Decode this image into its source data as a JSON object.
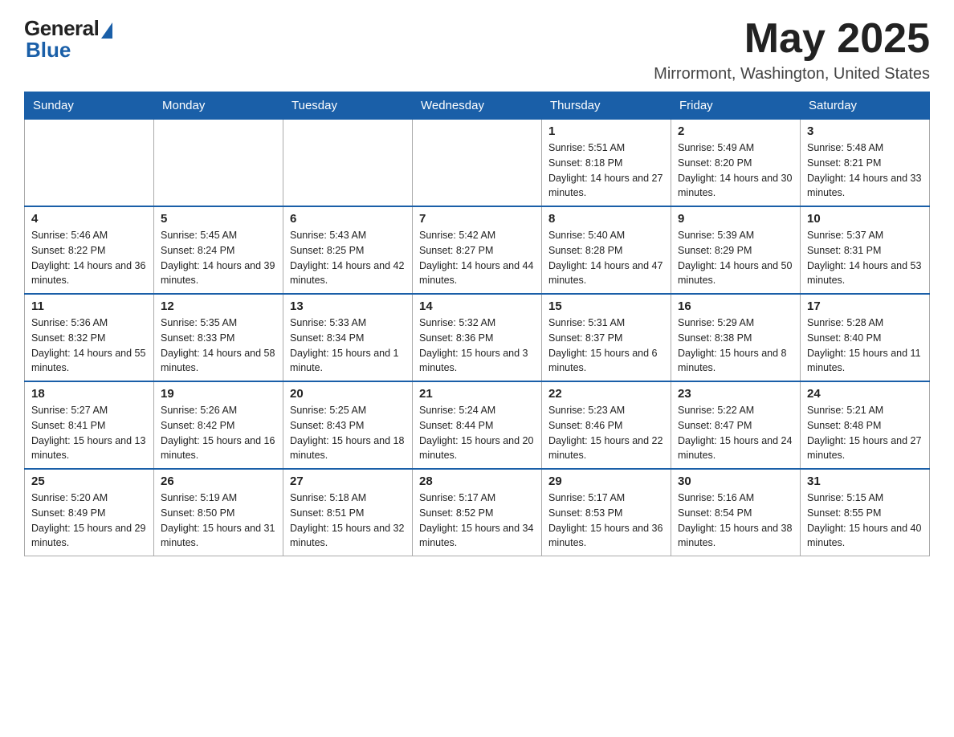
{
  "header": {
    "logo_general": "General",
    "logo_blue": "Blue",
    "month_title": "May 2025",
    "location": "Mirrormont, Washington, United States"
  },
  "weekdays": [
    "Sunday",
    "Monday",
    "Tuesday",
    "Wednesday",
    "Thursday",
    "Friday",
    "Saturday"
  ],
  "weeks": [
    [
      {
        "day": "",
        "sunrise": "",
        "sunset": "",
        "daylight": ""
      },
      {
        "day": "",
        "sunrise": "",
        "sunset": "",
        "daylight": ""
      },
      {
        "day": "",
        "sunrise": "",
        "sunset": "",
        "daylight": ""
      },
      {
        "day": "",
        "sunrise": "",
        "sunset": "",
        "daylight": ""
      },
      {
        "day": "1",
        "sunrise": "Sunrise: 5:51 AM",
        "sunset": "Sunset: 8:18 PM",
        "daylight": "Daylight: 14 hours and 27 minutes."
      },
      {
        "day": "2",
        "sunrise": "Sunrise: 5:49 AM",
        "sunset": "Sunset: 8:20 PM",
        "daylight": "Daylight: 14 hours and 30 minutes."
      },
      {
        "day": "3",
        "sunrise": "Sunrise: 5:48 AM",
        "sunset": "Sunset: 8:21 PM",
        "daylight": "Daylight: 14 hours and 33 minutes."
      }
    ],
    [
      {
        "day": "4",
        "sunrise": "Sunrise: 5:46 AM",
        "sunset": "Sunset: 8:22 PM",
        "daylight": "Daylight: 14 hours and 36 minutes."
      },
      {
        "day": "5",
        "sunrise": "Sunrise: 5:45 AM",
        "sunset": "Sunset: 8:24 PM",
        "daylight": "Daylight: 14 hours and 39 minutes."
      },
      {
        "day": "6",
        "sunrise": "Sunrise: 5:43 AM",
        "sunset": "Sunset: 8:25 PM",
        "daylight": "Daylight: 14 hours and 42 minutes."
      },
      {
        "day": "7",
        "sunrise": "Sunrise: 5:42 AM",
        "sunset": "Sunset: 8:27 PM",
        "daylight": "Daylight: 14 hours and 44 minutes."
      },
      {
        "day": "8",
        "sunrise": "Sunrise: 5:40 AM",
        "sunset": "Sunset: 8:28 PM",
        "daylight": "Daylight: 14 hours and 47 minutes."
      },
      {
        "day": "9",
        "sunrise": "Sunrise: 5:39 AM",
        "sunset": "Sunset: 8:29 PM",
        "daylight": "Daylight: 14 hours and 50 minutes."
      },
      {
        "day": "10",
        "sunrise": "Sunrise: 5:37 AM",
        "sunset": "Sunset: 8:31 PM",
        "daylight": "Daylight: 14 hours and 53 minutes."
      }
    ],
    [
      {
        "day": "11",
        "sunrise": "Sunrise: 5:36 AM",
        "sunset": "Sunset: 8:32 PM",
        "daylight": "Daylight: 14 hours and 55 minutes."
      },
      {
        "day": "12",
        "sunrise": "Sunrise: 5:35 AM",
        "sunset": "Sunset: 8:33 PM",
        "daylight": "Daylight: 14 hours and 58 minutes."
      },
      {
        "day": "13",
        "sunrise": "Sunrise: 5:33 AM",
        "sunset": "Sunset: 8:34 PM",
        "daylight": "Daylight: 15 hours and 1 minute."
      },
      {
        "day": "14",
        "sunrise": "Sunrise: 5:32 AM",
        "sunset": "Sunset: 8:36 PM",
        "daylight": "Daylight: 15 hours and 3 minutes."
      },
      {
        "day": "15",
        "sunrise": "Sunrise: 5:31 AM",
        "sunset": "Sunset: 8:37 PM",
        "daylight": "Daylight: 15 hours and 6 minutes."
      },
      {
        "day": "16",
        "sunrise": "Sunrise: 5:29 AM",
        "sunset": "Sunset: 8:38 PM",
        "daylight": "Daylight: 15 hours and 8 minutes."
      },
      {
        "day": "17",
        "sunrise": "Sunrise: 5:28 AM",
        "sunset": "Sunset: 8:40 PM",
        "daylight": "Daylight: 15 hours and 11 minutes."
      }
    ],
    [
      {
        "day": "18",
        "sunrise": "Sunrise: 5:27 AM",
        "sunset": "Sunset: 8:41 PM",
        "daylight": "Daylight: 15 hours and 13 minutes."
      },
      {
        "day": "19",
        "sunrise": "Sunrise: 5:26 AM",
        "sunset": "Sunset: 8:42 PM",
        "daylight": "Daylight: 15 hours and 16 minutes."
      },
      {
        "day": "20",
        "sunrise": "Sunrise: 5:25 AM",
        "sunset": "Sunset: 8:43 PM",
        "daylight": "Daylight: 15 hours and 18 minutes."
      },
      {
        "day": "21",
        "sunrise": "Sunrise: 5:24 AM",
        "sunset": "Sunset: 8:44 PM",
        "daylight": "Daylight: 15 hours and 20 minutes."
      },
      {
        "day": "22",
        "sunrise": "Sunrise: 5:23 AM",
        "sunset": "Sunset: 8:46 PM",
        "daylight": "Daylight: 15 hours and 22 minutes."
      },
      {
        "day": "23",
        "sunrise": "Sunrise: 5:22 AM",
        "sunset": "Sunset: 8:47 PM",
        "daylight": "Daylight: 15 hours and 24 minutes."
      },
      {
        "day": "24",
        "sunrise": "Sunrise: 5:21 AM",
        "sunset": "Sunset: 8:48 PM",
        "daylight": "Daylight: 15 hours and 27 minutes."
      }
    ],
    [
      {
        "day": "25",
        "sunrise": "Sunrise: 5:20 AM",
        "sunset": "Sunset: 8:49 PM",
        "daylight": "Daylight: 15 hours and 29 minutes."
      },
      {
        "day": "26",
        "sunrise": "Sunrise: 5:19 AM",
        "sunset": "Sunset: 8:50 PM",
        "daylight": "Daylight: 15 hours and 31 minutes."
      },
      {
        "day": "27",
        "sunrise": "Sunrise: 5:18 AM",
        "sunset": "Sunset: 8:51 PM",
        "daylight": "Daylight: 15 hours and 32 minutes."
      },
      {
        "day": "28",
        "sunrise": "Sunrise: 5:17 AM",
        "sunset": "Sunset: 8:52 PM",
        "daylight": "Daylight: 15 hours and 34 minutes."
      },
      {
        "day": "29",
        "sunrise": "Sunrise: 5:17 AM",
        "sunset": "Sunset: 8:53 PM",
        "daylight": "Daylight: 15 hours and 36 minutes."
      },
      {
        "day": "30",
        "sunrise": "Sunrise: 5:16 AM",
        "sunset": "Sunset: 8:54 PM",
        "daylight": "Daylight: 15 hours and 38 minutes."
      },
      {
        "day": "31",
        "sunrise": "Sunrise: 5:15 AM",
        "sunset": "Sunset: 8:55 PM",
        "daylight": "Daylight: 15 hours and 40 minutes."
      }
    ]
  ]
}
